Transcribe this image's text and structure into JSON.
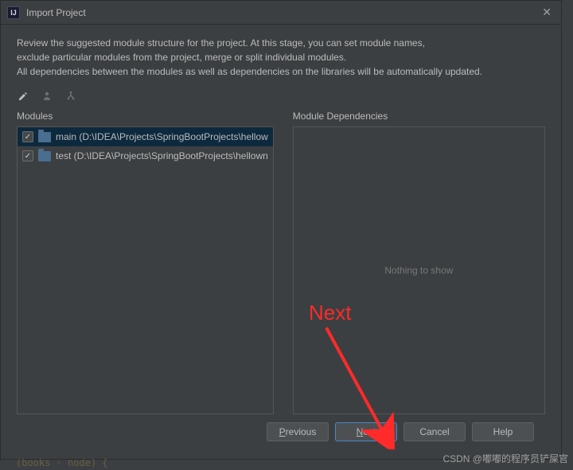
{
  "titlebar": {
    "title": "Import Project"
  },
  "description": {
    "line1": "Review the suggested module structure for the project. At this stage, you can set module names,",
    "line2": "exclude particular modules from the project, merge or split individual modules.",
    "line3": "All dependencies between the modules as well as dependencies on the libraries will be automatically updated."
  },
  "columns": {
    "modules_label": "Modules",
    "deps_label": "Module Dependencies"
  },
  "modules": [
    {
      "name": "main",
      "path": "D:\\IDEA\\Projects\\SpringBootProjects\\hellow",
      "checked": true,
      "selected": true
    },
    {
      "name": "test",
      "path": "D:\\IDEA\\Projects\\SpringBootProjects\\hellown",
      "checked": true,
      "selected": false
    }
  ],
  "deps": {
    "empty_text": "Nothing to show"
  },
  "buttons": {
    "previous": "Previous",
    "next": "Next",
    "cancel": "Cancel",
    "help": "Help"
  },
  "annotation": {
    "text": "Next"
  },
  "watermark": "CSDN @嘟嘟的程序员铲屎官",
  "bg_code": "(books · node) {"
}
